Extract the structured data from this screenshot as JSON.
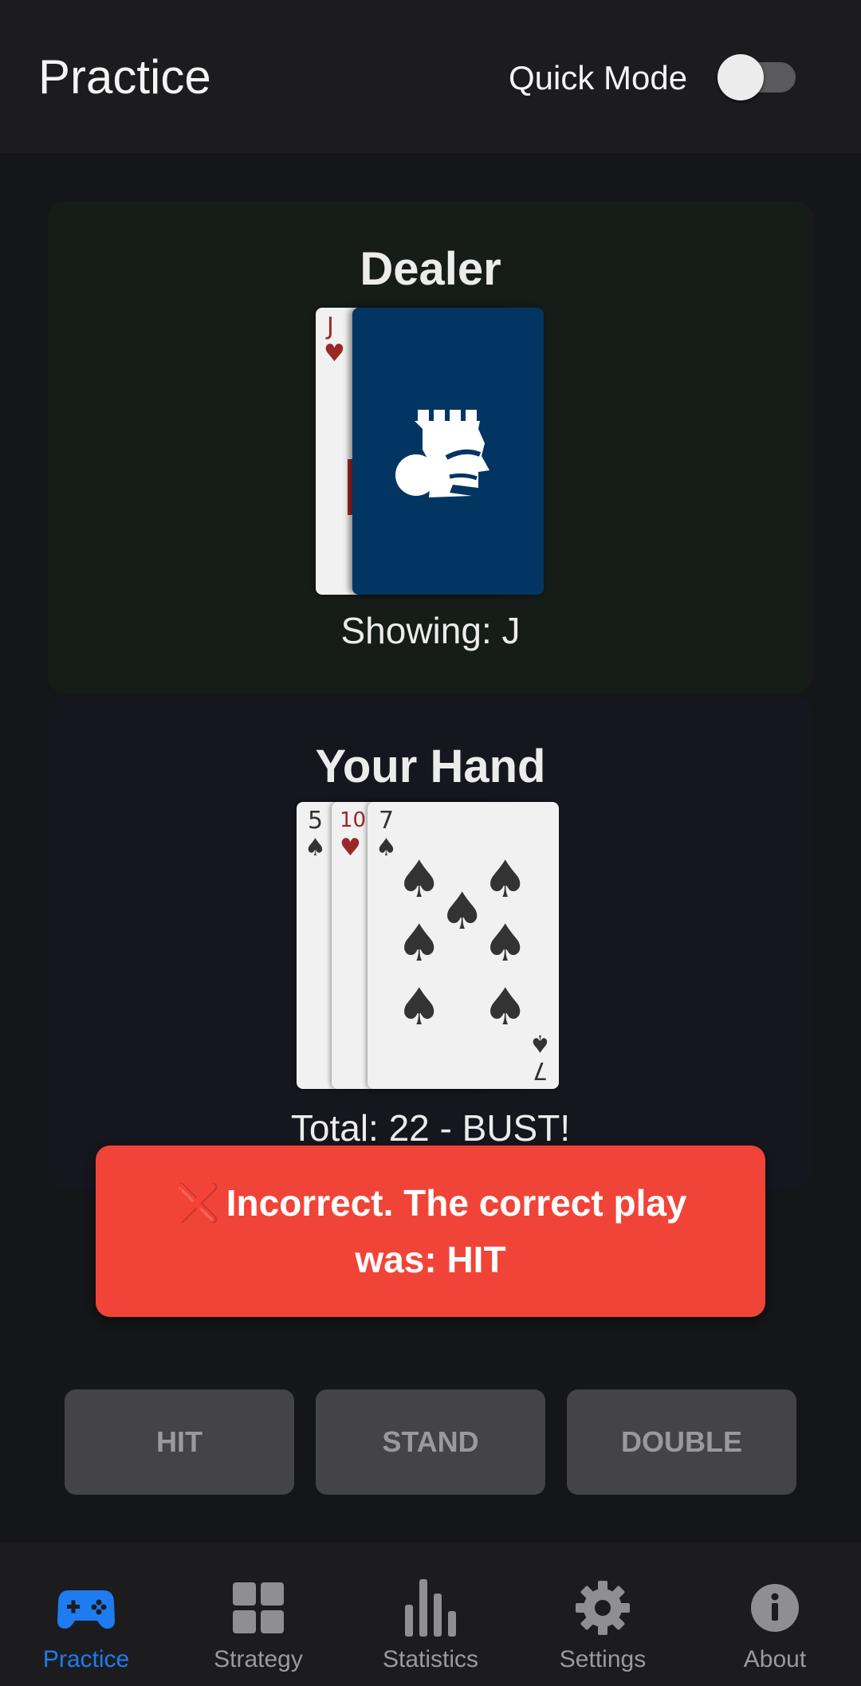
{
  "header": {
    "title": "Practice",
    "quick_mode_label": "Quick Mode",
    "quick_mode_on": false
  },
  "dealer": {
    "title": "Dealer",
    "up_card": {
      "rank": "J",
      "suit": "hearts",
      "suit_symbol": "♥"
    },
    "hole_card": "face-down",
    "showing_text": "Showing: J"
  },
  "player": {
    "title": "Your Hand",
    "cards": [
      {
        "rank": "5",
        "suit": "spades",
        "suit_symbol": "♠"
      },
      {
        "rank": "10",
        "suit": "hearts",
        "suit_symbol": "♥"
      },
      {
        "rank": "7",
        "suit": "spades",
        "suit_symbol": "♠"
      }
    ],
    "total_text": "Total: 22 - BUST!"
  },
  "feedback": {
    "icon": "cross-mark-icon",
    "icon_glyph": "❌",
    "message": "Incorrect. The correct play was: HIT",
    "color": "#f14438"
  },
  "actions": {
    "hit": "HIT",
    "stand": "STAND",
    "double": "DOUBLE"
  },
  "nav": {
    "active_color": "#1f7bf0",
    "items": [
      {
        "label": "Practice",
        "icon": "gamepad-icon",
        "active": true
      },
      {
        "label": "Strategy",
        "icon": "grid-icon",
        "active": false
      },
      {
        "label": "Statistics",
        "icon": "bar-chart-icon",
        "active": false
      },
      {
        "label": "Settings",
        "icon": "gear-icon",
        "active": false
      },
      {
        "label": "About",
        "icon": "info-icon",
        "active": false
      }
    ]
  }
}
